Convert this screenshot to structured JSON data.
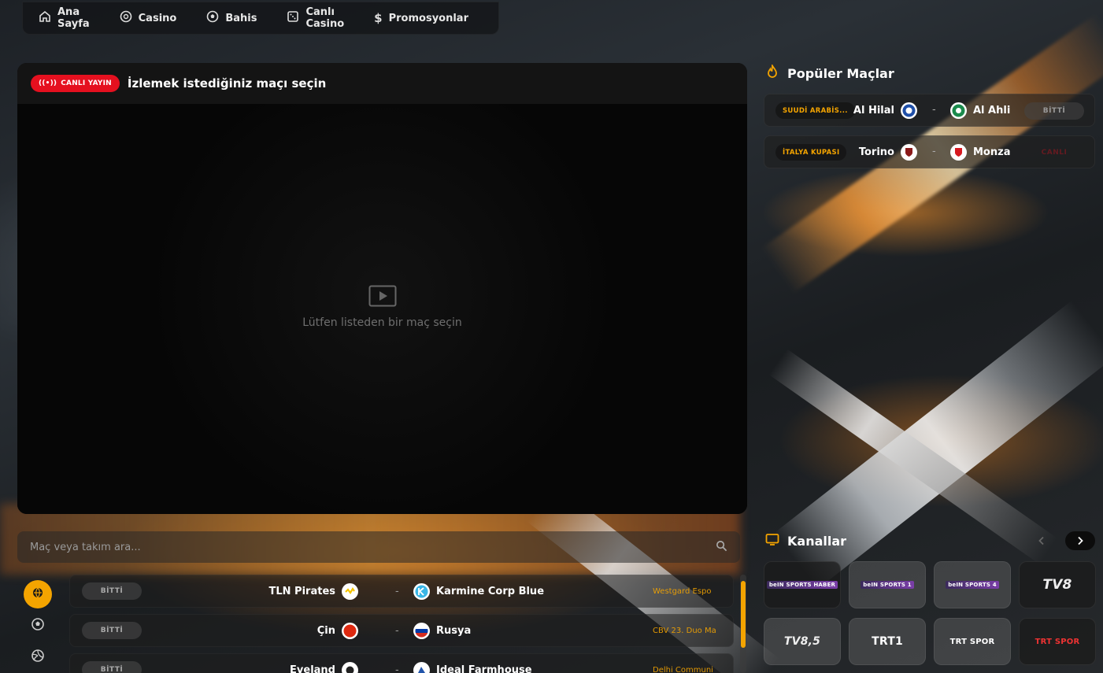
{
  "nav": {
    "items": [
      {
        "label": "Ana Sayfa",
        "icon": "home-icon"
      },
      {
        "label": "Casino",
        "icon": "casino-chip-icon"
      },
      {
        "label": "Bahis",
        "icon": "soccer-ball-icon"
      },
      {
        "label": "Canlı Casino",
        "icon": "dice-icon"
      },
      {
        "label": "Promosyonlar",
        "icon": "dollar-icon"
      }
    ]
  },
  "player": {
    "live_badge": "CANLI YAYIN",
    "title": "İzlemek istediğiniz maçı seçin",
    "placeholder": "Lütfen listeden bir maç seçin"
  },
  "search": {
    "placeholder": "Maç veya takım ara..."
  },
  "matches": [
    {
      "status": "BİTTİ",
      "home": "TLN Pirates",
      "away": "Karmine Corp Blue",
      "league": "Westgard Espo"
    },
    {
      "status": "BİTTİ",
      "home": "Çin",
      "away": "Rusya",
      "league": "CBV 23. Duo Ma"
    },
    {
      "status": "BİTTİ",
      "home": "Eveland",
      "away": "Ideal Farmhouse",
      "league": "Delhi Communi"
    }
  ],
  "popular": {
    "title": "Popüler Maçlar",
    "matches": [
      {
        "league": "SUUDİ ARABİS...",
        "home": "Al Hilal",
        "away": "Al Ahli",
        "status": "BİTTİ"
      },
      {
        "league": "İTALYA KUPASI",
        "home": "Torino",
        "away": "Monza",
        "status": "CANLI"
      }
    ]
  },
  "channels": {
    "title": "Kanallar",
    "items": [
      {
        "label": "beIN SPORTS HABER"
      },
      {
        "label": "beIN SPORTS 1"
      },
      {
        "label": "beIN SPORTS 4"
      },
      {
        "label": "TV8"
      },
      {
        "label": "TV8,5"
      },
      {
        "label": "TRT1"
      },
      {
        "label": "TRT SPOR"
      },
      {
        "label": "TRT SPOR"
      }
    ]
  },
  "colors": {
    "accent": "#f4a400",
    "live": "#e5101f"
  },
  "sport_filters": [
    "all-sports-icon",
    "soccer-ball-icon",
    "volleyball-icon"
  ]
}
